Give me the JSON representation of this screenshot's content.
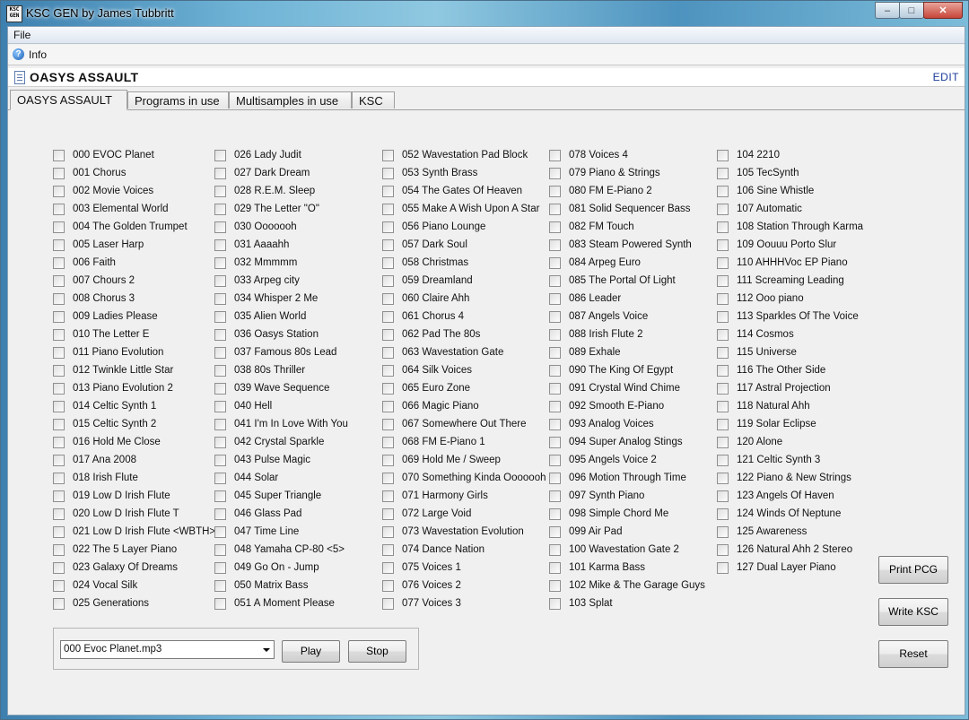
{
  "window": {
    "title": "KSC GEN by James Tubbritt",
    "app_icon_text": "KSC GEN",
    "controls": {
      "minimize": "–",
      "maximize": "□",
      "close": "✕"
    }
  },
  "menu": {
    "file": "File"
  },
  "toolbar": {
    "info_label": "Info",
    "info_icon": "info-icon"
  },
  "document": {
    "title": "OASYS ASSAULT",
    "edit_label": "EDIT"
  },
  "tabs": [
    "OASYS ASSAULT",
    "Programs in use",
    "Multisamples in use",
    "KSC"
  ],
  "columns": [
    [
      "000 EVOC Planet",
      "001 Chorus",
      "002 Movie Voices",
      "003 Elemental World",
      "004 The Golden Trumpet",
      "005 Laser Harp",
      "006 Faith",
      "007 Chours 2",
      "008 Chorus 3",
      "009 Ladies Please",
      "010 The Letter E",
      "011 Piano Evolution",
      "012 Twinkle Little Star",
      "013 Piano Evolution 2",
      "014 Celtic Synth 1",
      "015 Celtic Synth 2",
      "016 Hold Me Close",
      "017 Ana 2008",
      "018 Irish Flute",
      "019 Low D Irish Flute",
      "020 Low D Irish Flute T",
      "021 Low D Irish Flute <WBTH>",
      "022 The 5 Layer Piano",
      "023 Galaxy Of Dreams",
      "024 Vocal Silk",
      "025 Generations"
    ],
    [
      "026 Lady Judit",
      "027 Dark Dream",
      "028 R.E.M. Sleep",
      "029 The Letter \"O\"",
      "030 Ooooooh",
      "031 Aaaahh",
      "032 Mmmmm",
      "033 Arpeg city",
      "034 Whisper 2 Me",
      "035 Alien World",
      "036 Oasys Station",
      "037 Famous 80s Lead",
      "038 80s Thriller",
      "039 Wave Sequence",
      "040 Hell",
      "041 I'm In Love With You",
      "042 Crystal Sparkle",
      "043 Pulse Magic",
      "044 Solar",
      "045 Super Triangle",
      "046 Glass Pad",
      "047 Time Line",
      "048 Yamaha CP-80 <5>",
      "049 Go On - Jump",
      "050 Matrix Bass",
      "051 A Moment Please"
    ],
    [
      "052 Wavestation Pad Block",
      "053 Synth Brass",
      "054 The Gates Of Heaven",
      "055 Make A Wish Upon A Star",
      "056 Piano Lounge",
      "057 Dark Soul",
      "058 Christmas",
      "059 Dreamland",
      "060 Claire Ahh",
      "061 Chorus 4",
      "062 Pad The 80s",
      "063 Wavestation Gate",
      "064 Silk Voices",
      "065 Euro Zone",
      "066 Magic Piano",
      "067 Somewhere Out There",
      "068 FM E-Piano 1",
      "069 Hold Me / Sweep",
      "070 Something Kinda Ooooooh",
      "071 Harmony Girls",
      "072 Large Void",
      "073 Wavestation Evolution",
      "074 Dance Nation",
      "075 Voices 1",
      "076 Voices 2",
      "077 Voices 3"
    ],
    [
      "078 Voices 4",
      "079 Piano & Strings",
      "080 FM E-Piano 2",
      "081 Solid Sequencer Bass",
      "082 FM Touch",
      "083 Steam Powered Synth",
      "084 Arpeg Euro",
      "085 The Portal Of Light",
      "086 Leader",
      "087 Angels Voice",
      "088 Irish Flute 2",
      "089 Exhale",
      "090 The King Of Egypt",
      "091 Crystal Wind Chime",
      "092 Smooth E-Piano",
      "093 Analog Voices",
      "094 Super Analog Stings",
      "095 Angels Voice 2",
      "096 Motion Through Time",
      "097 Synth Piano",
      "098 Simple Chord Me",
      "099 Air Pad",
      "100 Wavestation Gate 2",
      "101 Karma Bass",
      "102 Mike & The Garage Guys",
      "103 Splat"
    ],
    [
      "104 2210",
      "105 TecSynth",
      "106 Sine Whistle",
      "107 Automatic",
      "108 Station Through Karma",
      "109 Oouuu Porto Slur",
      "110 AHHHVoc EP Piano",
      "111 Screaming Leading",
      "112 Ooo piano",
      "113 Sparkles Of The Voice",
      "114 Cosmos",
      "115 Universe",
      "116 The Other Side",
      "117 Astral Projection",
      "118 Natural Ahh",
      "119 Solar Eclipse",
      "120 Alone",
      "121 Celtic Synth 3",
      "122 Piano & New Strings",
      "123 Angels Of Haven",
      "124 Winds Of Neptune",
      "125 Awareness",
      "126 Natural Ahh 2 Stereo",
      "127 Dual Layer Piano"
    ]
  ],
  "player": {
    "selected_file": "000 Evoc Planet.mp3",
    "play_label": "Play",
    "stop_label": "Stop"
  },
  "side_buttons": {
    "print_pcg": "Print PCG",
    "write_ksc": "Write KSC",
    "reset": "Reset"
  }
}
